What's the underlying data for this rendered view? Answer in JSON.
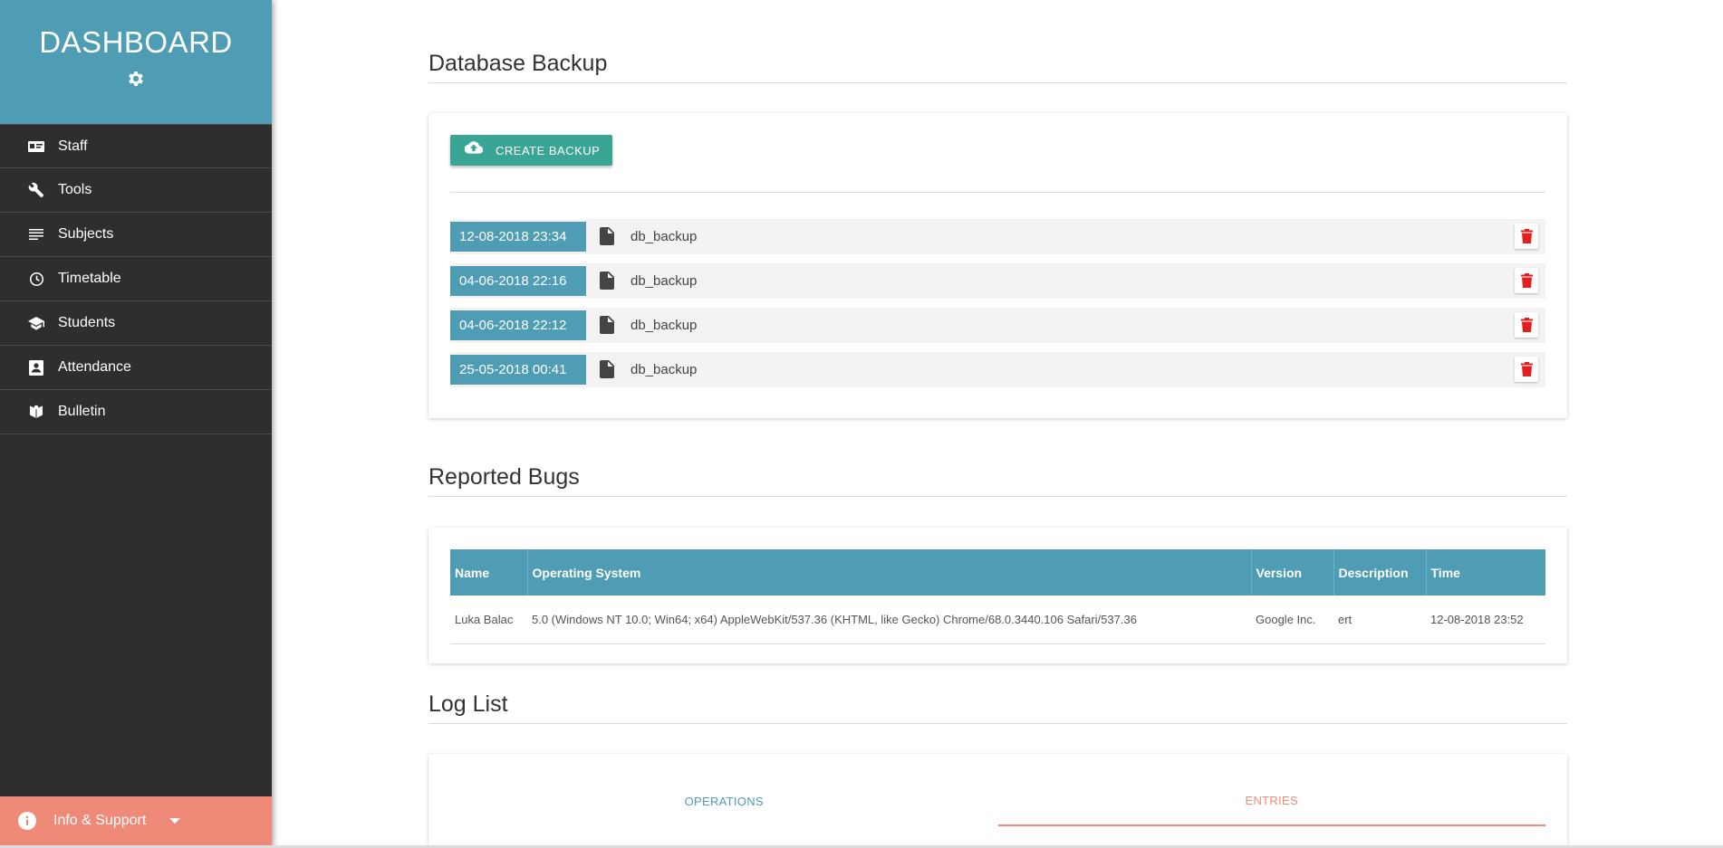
{
  "brand": {
    "title": "DASHBOARD",
    "gear_icon": "gear-icon"
  },
  "sidebar": {
    "items": [
      {
        "label": "Staff",
        "icon": "id-card-icon"
      },
      {
        "label": "Tools",
        "icon": "wrench-icon"
      },
      {
        "label": "Subjects",
        "icon": "lines-icon"
      },
      {
        "label": "Timetable",
        "icon": "clock-icon"
      },
      {
        "label": "Students",
        "icon": "graduation-cap-icon"
      },
      {
        "label": "Attendance",
        "icon": "contact-card-icon"
      },
      {
        "label": "Bulletin",
        "icon": "open-book-icon"
      }
    ],
    "footer": {
      "label": "Info & Support",
      "icon": "info-icon"
    }
  },
  "backup": {
    "title": "Database Backup",
    "create_label": "CREATE BACKUP",
    "rows": [
      {
        "date": "12-08-2018 23:34",
        "name": "db_backup"
      },
      {
        "date": "04-06-2018 22:16",
        "name": "db_backup"
      },
      {
        "date": "04-06-2018 22:12",
        "name": "db_backup"
      },
      {
        "date": "25-05-2018 00:41",
        "name": "db_backup"
      }
    ]
  },
  "bugs": {
    "title": "Reported Bugs",
    "columns": [
      "Name",
      "Operating System",
      "Version",
      "Description",
      "Time"
    ],
    "rows": [
      [
        "Luka Balac",
        "5.0 (Windows NT 10.0; Win64; x64) AppleWebKit/537.36 (KHTML, like Gecko) Chrome/68.0.3440.106 Safari/537.36",
        "Google Inc.",
        "ert",
        "12-08-2018 23:52"
      ]
    ]
  },
  "log": {
    "title": "Log List",
    "tabs": [
      "OPERATIONS",
      "ENTRIES"
    ],
    "active_tab": "ENTRIES"
  },
  "colors": {
    "brand": "#4f9db4",
    "sidebar": "#2e2e2e",
    "accent": "#ef8a78",
    "button": "#3aa595",
    "danger": "#e0201c"
  }
}
